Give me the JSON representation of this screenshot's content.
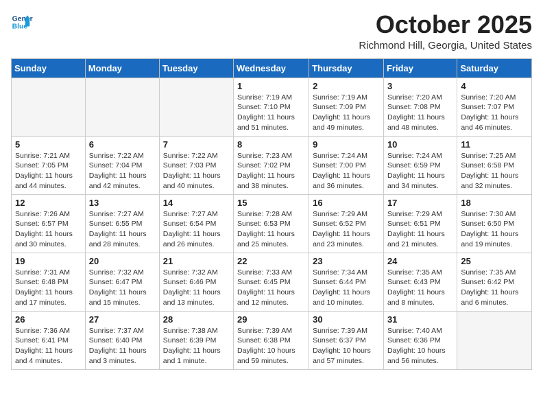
{
  "header": {
    "logo_line1": "General",
    "logo_line2": "Blue",
    "month_title": "October 2025",
    "location": "Richmond Hill, Georgia, United States"
  },
  "days_of_week": [
    "Sunday",
    "Monday",
    "Tuesday",
    "Wednesday",
    "Thursday",
    "Friday",
    "Saturday"
  ],
  "weeks": [
    [
      {
        "day": "",
        "info": ""
      },
      {
        "day": "",
        "info": ""
      },
      {
        "day": "",
        "info": ""
      },
      {
        "day": "1",
        "info": "Sunrise: 7:19 AM\nSunset: 7:10 PM\nDaylight: 11 hours\nand 51 minutes."
      },
      {
        "day": "2",
        "info": "Sunrise: 7:19 AM\nSunset: 7:09 PM\nDaylight: 11 hours\nand 49 minutes."
      },
      {
        "day": "3",
        "info": "Sunrise: 7:20 AM\nSunset: 7:08 PM\nDaylight: 11 hours\nand 48 minutes."
      },
      {
        "day": "4",
        "info": "Sunrise: 7:20 AM\nSunset: 7:07 PM\nDaylight: 11 hours\nand 46 minutes."
      }
    ],
    [
      {
        "day": "5",
        "info": "Sunrise: 7:21 AM\nSunset: 7:05 PM\nDaylight: 11 hours\nand 44 minutes."
      },
      {
        "day": "6",
        "info": "Sunrise: 7:22 AM\nSunset: 7:04 PM\nDaylight: 11 hours\nand 42 minutes."
      },
      {
        "day": "7",
        "info": "Sunrise: 7:22 AM\nSunset: 7:03 PM\nDaylight: 11 hours\nand 40 minutes."
      },
      {
        "day": "8",
        "info": "Sunrise: 7:23 AM\nSunset: 7:02 PM\nDaylight: 11 hours\nand 38 minutes."
      },
      {
        "day": "9",
        "info": "Sunrise: 7:24 AM\nSunset: 7:00 PM\nDaylight: 11 hours\nand 36 minutes."
      },
      {
        "day": "10",
        "info": "Sunrise: 7:24 AM\nSunset: 6:59 PM\nDaylight: 11 hours\nand 34 minutes."
      },
      {
        "day": "11",
        "info": "Sunrise: 7:25 AM\nSunset: 6:58 PM\nDaylight: 11 hours\nand 32 minutes."
      }
    ],
    [
      {
        "day": "12",
        "info": "Sunrise: 7:26 AM\nSunset: 6:57 PM\nDaylight: 11 hours\nand 30 minutes."
      },
      {
        "day": "13",
        "info": "Sunrise: 7:27 AM\nSunset: 6:55 PM\nDaylight: 11 hours\nand 28 minutes."
      },
      {
        "day": "14",
        "info": "Sunrise: 7:27 AM\nSunset: 6:54 PM\nDaylight: 11 hours\nand 26 minutes."
      },
      {
        "day": "15",
        "info": "Sunrise: 7:28 AM\nSunset: 6:53 PM\nDaylight: 11 hours\nand 25 minutes."
      },
      {
        "day": "16",
        "info": "Sunrise: 7:29 AM\nSunset: 6:52 PM\nDaylight: 11 hours\nand 23 minutes."
      },
      {
        "day": "17",
        "info": "Sunrise: 7:29 AM\nSunset: 6:51 PM\nDaylight: 11 hours\nand 21 minutes."
      },
      {
        "day": "18",
        "info": "Sunrise: 7:30 AM\nSunset: 6:50 PM\nDaylight: 11 hours\nand 19 minutes."
      }
    ],
    [
      {
        "day": "19",
        "info": "Sunrise: 7:31 AM\nSunset: 6:48 PM\nDaylight: 11 hours\nand 17 minutes."
      },
      {
        "day": "20",
        "info": "Sunrise: 7:32 AM\nSunset: 6:47 PM\nDaylight: 11 hours\nand 15 minutes."
      },
      {
        "day": "21",
        "info": "Sunrise: 7:32 AM\nSunset: 6:46 PM\nDaylight: 11 hours\nand 13 minutes."
      },
      {
        "day": "22",
        "info": "Sunrise: 7:33 AM\nSunset: 6:45 PM\nDaylight: 11 hours\nand 12 minutes."
      },
      {
        "day": "23",
        "info": "Sunrise: 7:34 AM\nSunset: 6:44 PM\nDaylight: 11 hours\nand 10 minutes."
      },
      {
        "day": "24",
        "info": "Sunrise: 7:35 AM\nSunset: 6:43 PM\nDaylight: 11 hours\nand 8 minutes."
      },
      {
        "day": "25",
        "info": "Sunrise: 7:35 AM\nSunset: 6:42 PM\nDaylight: 11 hours\nand 6 minutes."
      }
    ],
    [
      {
        "day": "26",
        "info": "Sunrise: 7:36 AM\nSunset: 6:41 PM\nDaylight: 11 hours\nand 4 minutes."
      },
      {
        "day": "27",
        "info": "Sunrise: 7:37 AM\nSunset: 6:40 PM\nDaylight: 11 hours\nand 3 minutes."
      },
      {
        "day": "28",
        "info": "Sunrise: 7:38 AM\nSunset: 6:39 PM\nDaylight: 11 hours\nand 1 minute."
      },
      {
        "day": "29",
        "info": "Sunrise: 7:39 AM\nSunset: 6:38 PM\nDaylight: 10 hours\nand 59 minutes."
      },
      {
        "day": "30",
        "info": "Sunrise: 7:39 AM\nSunset: 6:37 PM\nDaylight: 10 hours\nand 57 minutes."
      },
      {
        "day": "31",
        "info": "Sunrise: 7:40 AM\nSunset: 6:36 PM\nDaylight: 10 hours\nand 56 minutes."
      },
      {
        "day": "",
        "info": ""
      }
    ]
  ]
}
